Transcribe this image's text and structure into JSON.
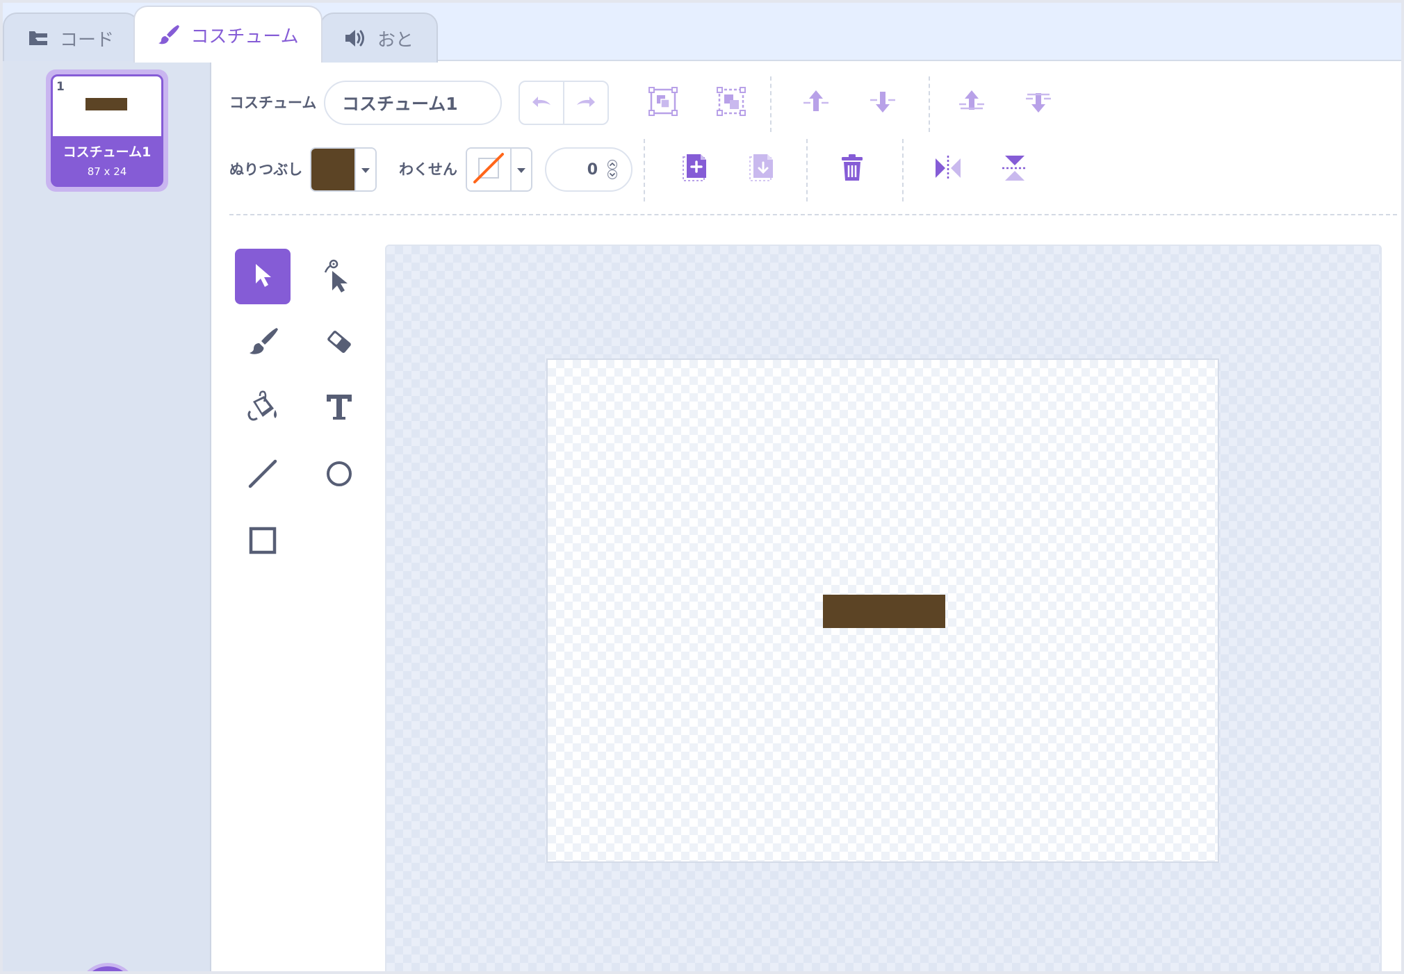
{
  "tabs": {
    "code": {
      "label": "コード",
      "icon": "code-blocks-icon"
    },
    "costumes": {
      "label": "コスチューム",
      "icon": "paintbrush-icon"
    },
    "sounds": {
      "label": "おと",
      "icon": "speaker-icon"
    }
  },
  "costume_list": {
    "items": [
      {
        "index": "1",
        "name": "コスチューム1",
        "size": "87 x 24"
      }
    ]
  },
  "toolbar": {
    "costume_label": "コスチューム",
    "costume_name": "コスチューム1",
    "fill_label": "ぬりつぶし",
    "fill_color": "#5c4425",
    "outline_label": "わくせん",
    "outline_color": "none",
    "outline_width": "0"
  },
  "tools": [
    "select",
    "reshape",
    "brush",
    "eraser",
    "fill",
    "text",
    "line",
    "circle",
    "rectangle"
  ],
  "colors": {
    "accent": "#855cd6",
    "accent_light": "#b8a1e8",
    "shape": "#5c4425",
    "outline_none_slash": "#ff661a",
    "text": "#575e75"
  },
  "canvas": {
    "shape_color": "#5c4425"
  }
}
